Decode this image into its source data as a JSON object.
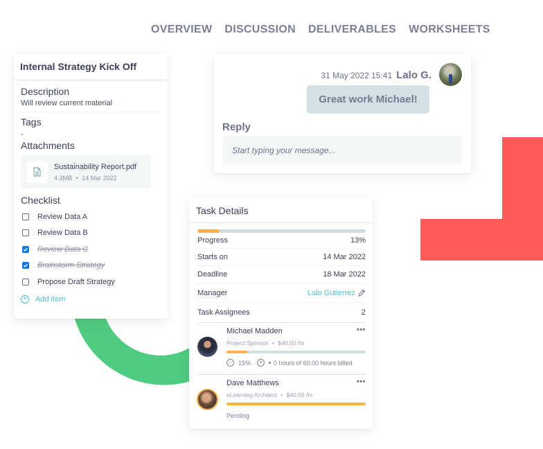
{
  "tabs": [
    {
      "label": "OVERVIEW"
    },
    {
      "label": "DISCUSSION"
    },
    {
      "label": "DELIVERABLES"
    },
    {
      "label": "WORKSHEETS"
    }
  ],
  "task_summary": {
    "title": "Internal Strategy Kick Off",
    "description_heading": "Description",
    "description": "Will review current material",
    "tags_heading": "Tags",
    "tags_value": "-",
    "attachments_heading": "Attachments",
    "attachments": [
      {
        "name": "Sustainability Report.pdf",
        "size": "4.3MB",
        "separator": "•",
        "date": "14 Mar 2022",
        "icon": "document-icon"
      }
    ],
    "checklist_heading": "Checklist",
    "checklist": [
      {
        "label": "Review Data A",
        "checked": false
      },
      {
        "label": "Review Data B",
        "checked": false
      },
      {
        "label": "Review Data C",
        "checked": true
      },
      {
        "label": "Brainstorm Strategy",
        "checked": true
      },
      {
        "label": "Propose Draft Strategy",
        "checked": false
      }
    ],
    "add_item_label": "Add item"
  },
  "discussion": {
    "message": {
      "timestamp": "31 May 2022 15:41",
      "author": "Lalo G.",
      "text": "Great work Michael!"
    },
    "reply_label": "Reply",
    "reply_placeholder": "Start typing your message..."
  },
  "task_details": {
    "title": "Task Details",
    "progress_fraction": 0.13,
    "rows": [
      {
        "label": "Progress",
        "value": "13%"
      },
      {
        "label": "Starts on",
        "value": "14 Mar 2022"
      },
      {
        "label": "Deadline",
        "value": "18 Mar 2022"
      },
      {
        "label": "Manager",
        "value": "Lalo Gutierrez"
      },
      {
        "label": "Task Assignees",
        "value": "2"
      }
    ],
    "assignees": [
      {
        "name": "Michael Madden",
        "role": "Project Sponsor",
        "separator": "•",
        "rate": "$40.00 /hr",
        "progress_fraction": 0.15,
        "percent_label": "15%",
        "billed_text": "0 hours of 60.00 hours billed",
        "more": "•••"
      },
      {
        "name": "Dave Matthews",
        "role": "eLearning Architect",
        "separator": "•",
        "rate": "$40.00 /hr",
        "progress_fraction": 1.0,
        "status": "Pending",
        "more": "•••"
      }
    ]
  },
  "colors": {
    "accent_teal": "#4dc0c8",
    "progress_orange": "#fbb04a",
    "checkbox_blue": "#1a73e8",
    "decor_red": "#fd5a5a",
    "decor_green": "#50cb82"
  }
}
